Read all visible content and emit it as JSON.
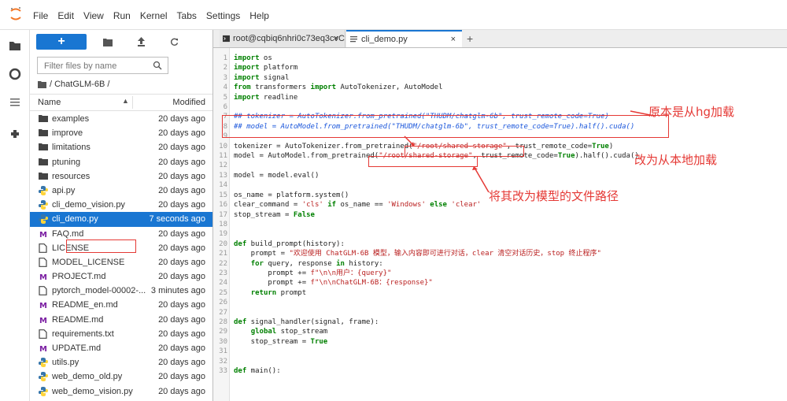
{
  "menu": [
    "File",
    "Edit",
    "View",
    "Run",
    "Kernel",
    "Tabs",
    "Settings",
    "Help"
  ],
  "toolbar": {
    "new_label": "+"
  },
  "filter": {
    "placeholder": "Filter files by name"
  },
  "breadcrumb": "/ ChatGLM-6B /",
  "columns": {
    "name": "Name",
    "modified": "Modified"
  },
  "files": [
    {
      "name": "examples",
      "modified": "20 days ago",
      "type": "folder"
    },
    {
      "name": "improve",
      "modified": "20 days ago",
      "type": "folder"
    },
    {
      "name": "limitations",
      "modified": "20 days ago",
      "type": "folder"
    },
    {
      "name": "ptuning",
      "modified": "20 days ago",
      "type": "folder"
    },
    {
      "name": "resources",
      "modified": "20 days ago",
      "type": "folder"
    },
    {
      "name": "api.py",
      "modified": "20 days ago",
      "type": "python"
    },
    {
      "name": "cli_demo_vision.py",
      "modified": "20 days ago",
      "type": "python"
    },
    {
      "name": "cli_demo.py",
      "modified": "7 seconds ago",
      "type": "python",
      "selected": true
    },
    {
      "name": "FAQ.md",
      "modified": "20 days ago",
      "type": "markdown"
    },
    {
      "name": "LICENSE",
      "modified": "20 days ago",
      "type": "file"
    },
    {
      "name": "MODEL_LICENSE",
      "modified": "20 days ago",
      "type": "file"
    },
    {
      "name": "PROJECT.md",
      "modified": "20 days ago",
      "type": "markdown"
    },
    {
      "name": "pytorch_model-00002-...",
      "modified": "3 minutes ago",
      "type": "file"
    },
    {
      "name": "README_en.md",
      "modified": "20 days ago",
      "type": "markdown"
    },
    {
      "name": "README.md",
      "modified": "20 days ago",
      "type": "markdown"
    },
    {
      "name": "requirements.txt",
      "modified": "20 days ago",
      "type": "file"
    },
    {
      "name": "UPDATE.md",
      "modified": "20 days ago",
      "type": "markdown"
    },
    {
      "name": "utils.py",
      "modified": "20 days ago",
      "type": "python"
    },
    {
      "name": "web_demo_old.py",
      "modified": "20 days ago",
      "type": "python"
    },
    {
      "name": "web_demo_vision.py",
      "modified": "20 days ago",
      "type": "python"
    }
  ],
  "tabs": [
    {
      "label": "root@cqbiq6nhri0c73eq3cvC",
      "close": "×"
    },
    {
      "label": "cli_demo.py",
      "close": "×"
    }
  ],
  "code_lines": [
    {
      "n": "1",
      "t": "import os"
    },
    {
      "n": "2",
      "t": "import platform"
    },
    {
      "n": "3",
      "t": "import signal"
    },
    {
      "n": "4",
      "t": "from transformers import AutoTokenizer, AutoModel"
    },
    {
      "n": "5",
      "t": "import readline"
    },
    {
      "n": "6",
      "t": ""
    },
    {
      "n": "7",
      "t": "## tokenizer = AutoTokenizer.from_pretrained(\"THUDM/chatglm-6b\", trust_remote_code=True)"
    },
    {
      "n": "8",
      "t": "## model = AutoModel.from_pretrained(\"THUDM/chatglm-6b\", trust_remote_code=True).half().cuda()"
    },
    {
      "n": "9",
      "t": ""
    },
    {
      "n": "10",
      "t": "tokenizer = AutoTokenizer.from_pretrained(\"/root/shared-storage\", trust_remote_code=True)"
    },
    {
      "n": "11",
      "t": "model = AutoModel.from_pretrained(\"/root/shared-storage\", trust_remote_code=True).half().cuda()"
    },
    {
      "n": "12",
      "t": ""
    },
    {
      "n": "13",
      "t": "model = model.eval()"
    },
    {
      "n": "14",
      "t": ""
    },
    {
      "n": "15",
      "t": "os_name = platform.system()"
    },
    {
      "n": "16",
      "t": "clear_command = 'cls' if os_name == 'Windows' else 'clear'"
    },
    {
      "n": "17",
      "t": "stop_stream = False"
    },
    {
      "n": "18",
      "t": ""
    },
    {
      "n": "19",
      "t": ""
    },
    {
      "n": "20",
      "t": "def build_prompt(history):"
    },
    {
      "n": "21",
      "t": "    prompt = \"欢迎使用 ChatGLM-6B 模型，输入内容即可进行对话，clear 清空对话历史，stop 终止程序\""
    },
    {
      "n": "22",
      "t": "    for query, response in history:"
    },
    {
      "n": "23",
      "t": "        prompt += f\"\\n\\n用户：{query}\""
    },
    {
      "n": "24",
      "t": "        prompt += f\"\\n\\nChatGLM-6B：{response}\""
    },
    {
      "n": "25",
      "t": "    return prompt"
    },
    {
      "n": "26",
      "t": ""
    },
    {
      "n": "27",
      "t": ""
    },
    {
      "n": "28",
      "t": "def signal_handler(signal, frame):"
    },
    {
      "n": "29",
      "t": "    global stop_stream"
    },
    {
      "n": "30",
      "t": "    stop_stream = True"
    },
    {
      "n": "31",
      "t": ""
    },
    {
      "n": "32",
      "t": ""
    },
    {
      "n": "33",
      "t": "def main():"
    }
  ],
  "annotations": {
    "original": "原本是从hg加载",
    "changed": "改为从本地加载",
    "path": "将其改为模型的文件路径"
  },
  "colors": {
    "accent": "#1976d2",
    "annotation": "#e53935"
  }
}
